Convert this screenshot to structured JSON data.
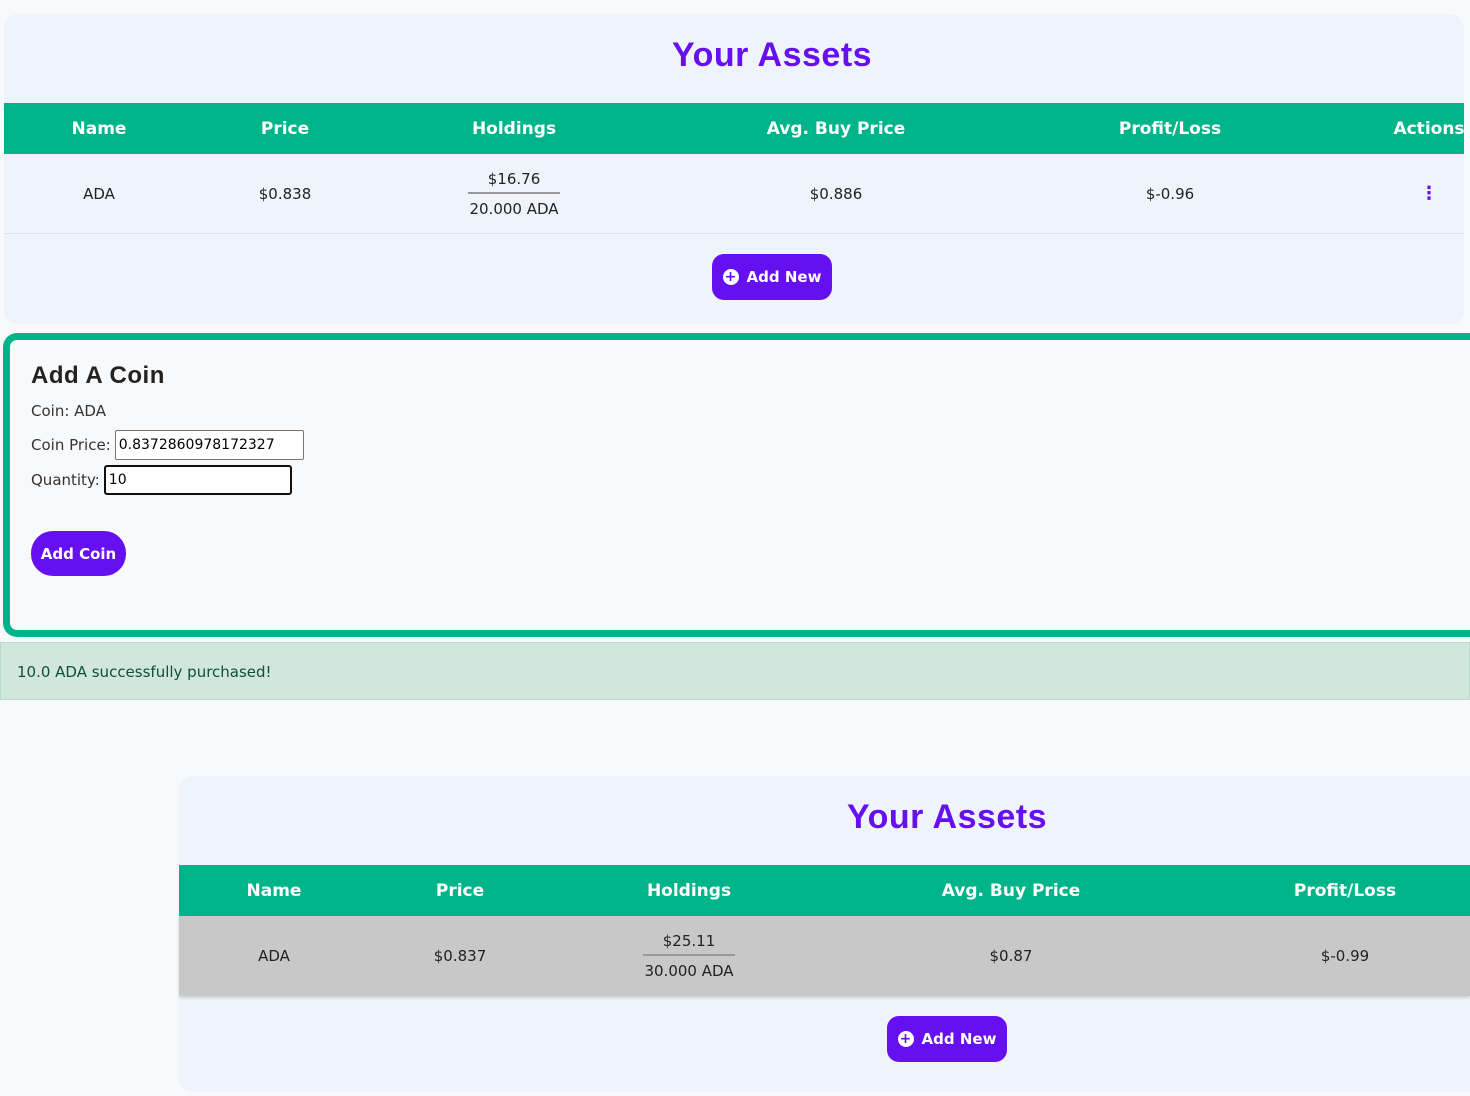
{
  "assets_top": {
    "title": "Your Assets",
    "headers": [
      "Name",
      "Price",
      "Holdings",
      "Avg. Buy Price",
      "Profit/Loss",
      "Actions"
    ],
    "row": {
      "name": "ADA",
      "price": "$0.838",
      "holdings_value": "$16.76",
      "holdings_qty": "20.000 ADA",
      "avg_buy": "$0.886",
      "pl": "$-0.96",
      "actions_icon": "kebab-menu-icon"
    },
    "add_new": "Add New"
  },
  "form": {
    "title": "Add A Coin",
    "coin_label": "Coin: ADA",
    "price_label": "Coin Price:",
    "price_value": "0.8372860978172327",
    "qty_label": "Quantity:",
    "qty_value": "10",
    "submit": "Add Coin"
  },
  "alert": "10.0 ADA successfully purchased!",
  "assets_bottom": {
    "title": "Your Assets",
    "headers": [
      "Name",
      "Price",
      "Holdings",
      "Avg. Buy Price",
      "Profit/Loss"
    ],
    "row": {
      "name": "ADA",
      "price": "$0.837",
      "holdings_value": "$25.11",
      "holdings_qty": "30.000 ADA",
      "avg_buy": "$0.87",
      "pl": "$-0.99"
    },
    "add_new": "Add New"
  },
  "colors": {
    "accent": "#6610f2",
    "header": "#00b48a",
    "alert_bg": "#d1e7dd"
  }
}
